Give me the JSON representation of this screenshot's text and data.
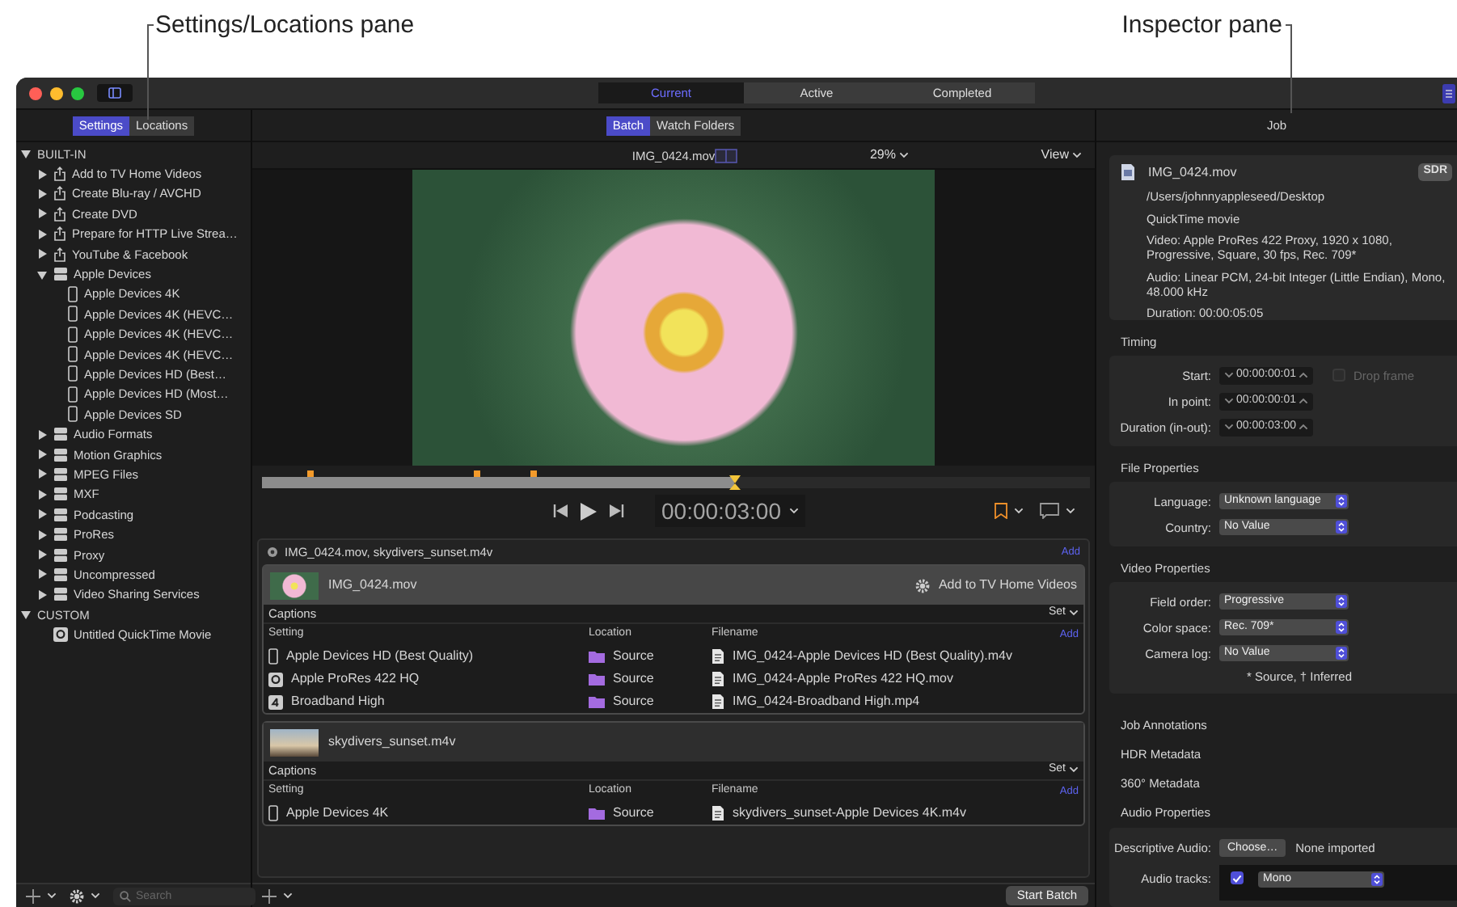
{
  "callouts": [
    {
      "label": "Settings/Locations pane"
    },
    {
      "label": "Inspector pane"
    }
  ],
  "window": {
    "tabs": [
      {
        "label": "Current",
        "selected": true
      },
      {
        "label": "Active",
        "selected": false
      },
      {
        "label": "Completed",
        "selected": false
      }
    ]
  },
  "settings_pane": {
    "tabs": [
      {
        "label": "Settings",
        "selected": true
      },
      {
        "label": "Locations",
        "selected": false
      }
    ],
    "tree": [
      {
        "label": "BUILT-IN",
        "kind": "section",
        "expanded": true,
        "children": [
          {
            "label": "Add to TV Home Videos",
            "kind": "share",
            "expanded": false
          },
          {
            "label": "Create Blu-ray / AVCHD",
            "kind": "share",
            "expanded": false
          },
          {
            "label": "Create DVD",
            "kind": "share",
            "expanded": false
          },
          {
            "label": "Prepare for HTTP Live Strea…",
            "kind": "share",
            "expanded": false
          },
          {
            "label": "YouTube & Facebook",
            "kind": "share",
            "expanded": false
          },
          {
            "label": "Apple Devices",
            "kind": "group",
            "expanded": true,
            "children": [
              {
                "label": "Apple Devices 4K",
                "kind": "device"
              },
              {
                "label": "Apple Devices 4K (HEVC…",
                "kind": "device"
              },
              {
                "label": "Apple Devices 4K (HEVC…",
                "kind": "device"
              },
              {
                "label": "Apple Devices 4K (HEVC…",
                "kind": "device"
              },
              {
                "label": "Apple Devices HD (Best…",
                "kind": "device"
              },
              {
                "label": "Apple Devices HD (Most…",
                "kind": "device"
              },
              {
                "label": "Apple Devices SD",
                "kind": "device"
              }
            ]
          },
          {
            "label": "Audio Formats",
            "kind": "group",
            "expanded": false
          },
          {
            "label": "Motion Graphics",
            "kind": "group",
            "expanded": false
          },
          {
            "label": "MPEG Files",
            "kind": "group",
            "expanded": false
          },
          {
            "label": "MXF",
            "kind": "group",
            "expanded": false
          },
          {
            "label": "Podcasting",
            "kind": "group",
            "expanded": false
          },
          {
            "label": "ProRes",
            "kind": "group",
            "expanded": false
          },
          {
            "label": "Proxy",
            "kind": "group",
            "expanded": false
          },
          {
            "label": "Uncompressed",
            "kind": "group",
            "expanded": false
          },
          {
            "label": "Video Sharing Services",
            "kind": "group",
            "expanded": false
          }
        ]
      },
      {
        "label": "CUSTOM",
        "kind": "section",
        "expanded": true,
        "children": [
          {
            "label": "Untitled QuickTime Movie",
            "kind": "quicktime"
          }
        ]
      }
    ],
    "search": {
      "placeholder": "Search"
    }
  },
  "batch_pane": {
    "tabs": [
      {
        "label": "Batch",
        "selected": true
      },
      {
        "label": "Watch Folders",
        "selected": false
      }
    ],
    "viewer": {
      "title": "IMG_0424.mov",
      "zoom": "29%",
      "view_menu": "View"
    },
    "timeline": {
      "level": 0.57
    },
    "timecode": "00:00:03:00",
    "batch": {
      "title": "IMG_0424.mov, skydivers_sunset.m4v",
      "add": "Add",
      "jobs": [
        {
          "source": "IMG_0424.mov",
          "selected": true,
          "setting_summary": "Add to TV Home Videos",
          "captions": "Captions",
          "set_menu": "Set",
          "columns": [
            "Setting",
            "Location",
            "Filename"
          ],
          "add": "Add",
          "outputs": [
            {
              "setting": "Apple Devices HD (Best Quality)",
              "kind": "device",
              "location": "Source",
              "filename": "IMG_0424-Apple Devices HD (Best Quality).m4v"
            },
            {
              "setting": "Apple ProRes 422 HQ",
              "kind": "quicktime",
              "location": "Source",
              "filename": "IMG_0424-Apple ProRes 422 HQ.mov"
            },
            {
              "setting": "Broadband High",
              "kind": "broadband",
              "location": "Source",
              "filename": "IMG_0424-Broadband High.mp4"
            }
          ]
        },
        {
          "source": "skydivers_sunset.m4v",
          "selected": false,
          "captions": "Captions",
          "set_menu": "Set",
          "columns": [
            "Setting",
            "Location",
            "Filename"
          ],
          "add": "Add",
          "outputs": [
            {
              "setting": "Apple Devices 4K",
              "kind": "device",
              "location": "Source",
              "filename": "skydivers_sunset-Apple Devices 4K.m4v"
            }
          ]
        }
      ]
    },
    "start_button": "Start Batch"
  },
  "inspector": {
    "title": "Job",
    "file": {
      "name": "IMG_0424.mov",
      "badge": "SDR",
      "path": "/Users/johnnyappleseed/Desktop",
      "type": "QuickTime movie",
      "video": "Video: Apple ProRes 422 Proxy, 1920 x 1080, Progressive, Square, 30 fps, Rec. 709*",
      "audio": "Audio: Linear PCM, 24-bit Integer (Little Endian), Mono, 48.000 kHz",
      "duration": "Duration: 00:00:05:05"
    },
    "sections": [
      {
        "title": "Timing",
        "kind": "timing",
        "fields": [
          {
            "label": "Start:",
            "value": "00:00:00:01"
          },
          {
            "label": "In point:",
            "value": "00:00:00:01"
          },
          {
            "label": "Duration (in-out):",
            "value": "00:00:03:00"
          }
        ],
        "drop_frame": {
          "label": "Drop frame",
          "checked": false,
          "disabled": true
        }
      },
      {
        "title": "File Properties",
        "kind": "popups",
        "fields": [
          {
            "label": "Language:",
            "value": "Unknown language"
          },
          {
            "label": "Country:",
            "value": "No Value"
          }
        ]
      },
      {
        "title": "Video Properties",
        "kind": "popups",
        "fields": [
          {
            "label": "Field order:",
            "value": "Progressive"
          },
          {
            "label": "Color space:",
            "value": "Rec. 709*"
          },
          {
            "label": "Camera log:",
            "value": "No Value"
          }
        ],
        "note": "* Source, † Inferred"
      },
      {
        "title": "Job Annotations",
        "kind": "collapsed"
      },
      {
        "title": "HDR Metadata",
        "kind": "collapsed"
      },
      {
        "title": "360° Metadata",
        "kind": "collapsed"
      },
      {
        "title": "Audio Properties",
        "kind": "audio",
        "descriptive_audio": {
          "label": "Descriptive Audio:",
          "button": "Choose…",
          "status": "None imported"
        },
        "tracks": {
          "label": "Audio tracks:",
          "items": [
            {
              "checked": true,
              "value": "Mono"
            }
          ]
        }
      }
    ]
  }
}
